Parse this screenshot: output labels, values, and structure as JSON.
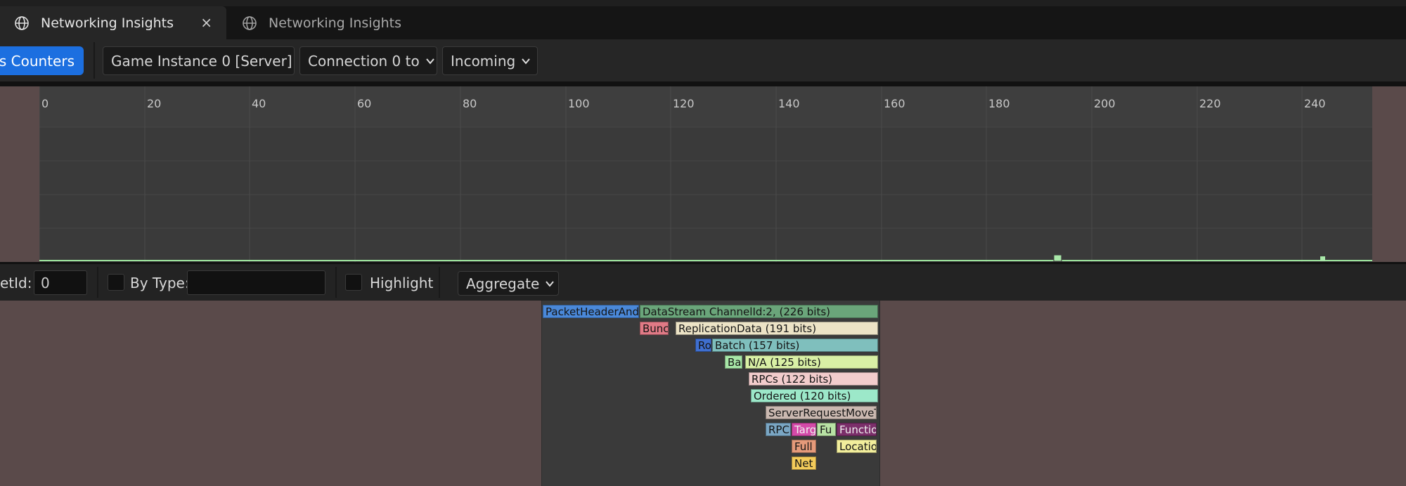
{
  "tabs": [
    {
      "label": "Networking Insights",
      "icon": "globe-icon",
      "active": true,
      "close": "×"
    },
    {
      "label": "Networking Insights",
      "icon": "globe-icon",
      "active": false
    }
  ],
  "toolbar": {
    "counters_button": "ats Counters",
    "game_instance": "Game Instance 0 [Server]",
    "connection": "Connection 0 to",
    "direction": "Incoming"
  },
  "graph": {
    "ticks": [
      "0",
      "20",
      "40",
      "60",
      "80",
      "100",
      "120",
      "140",
      "160",
      "180",
      "200",
      "220",
      "240"
    ]
  },
  "filters": {
    "netid_label": "etId:",
    "netid_value": "0",
    "by_type_label": "By Type:",
    "by_type_value": "",
    "highlight_label": "Highlight",
    "aggregate_label": "Aggregate"
  },
  "packet_tree": [
    {
      "text": "PacketHeaderAndI",
      "color": "#4a88d8"
    },
    {
      "text": "DataStream ChannelId:2,  (226 bits)",
      "color": "#6aa57a"
    },
    {
      "text": "Bunc",
      "color": "#e07a86"
    },
    {
      "text": "ReplicationData (191 bits)",
      "color": "#ece3c6"
    },
    {
      "text": "Ro",
      "color": "#3f6fd0"
    },
    {
      "text": "Batch (157 bits)",
      "color": "#7fbfbd"
    },
    {
      "text": "Ba",
      "color": "#a7e6a7"
    },
    {
      "text": "N/A (125 bits)",
      "color": "#d9f0a5"
    },
    {
      "text": "RPCs (122 bits)",
      "color": "#f2cccc"
    },
    {
      "text": "Ordered (120 bits)",
      "color": "#9ce8c9"
    },
    {
      "text": "ServerRequestMoveT",
      "color": "#cab8b0"
    },
    {
      "text": "RPC",
      "color": "#7aa6c4"
    },
    {
      "text": "Targ",
      "color": "#d44aa8"
    },
    {
      "text": "Fu",
      "color": "#b8e2a4"
    },
    {
      "text": "Functio",
      "color": "#7b2f6a"
    },
    {
      "text": "Full",
      "color": "#e59a7a"
    },
    {
      "text": "Locatio",
      "color": "#f2ee9c"
    },
    {
      "text": "Net",
      "color": "#f3cb5a"
    }
  ]
}
